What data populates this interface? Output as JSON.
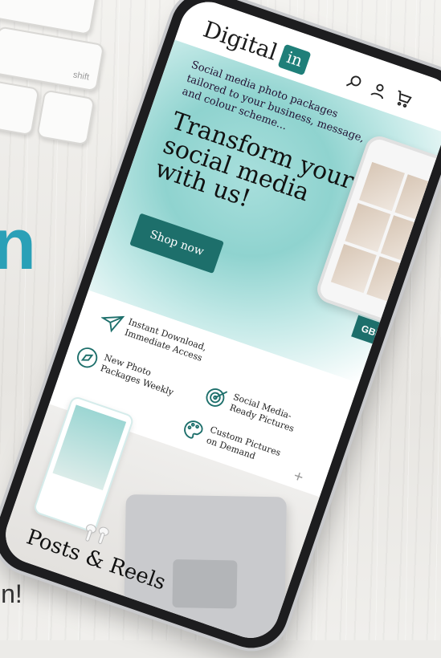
{
  "background": {
    "keyboard_key_label": "shift",
    "partial_heading": "n",
    "partial_bottom_text": "in!"
  },
  "site": {
    "logo_text": "Digital",
    "logo_badge": "in",
    "header_icons": [
      "search-icon",
      "user-icon",
      "cart-icon"
    ],
    "hero": {
      "subtitle": "Social media photo packages tailored to your business, message, and colour scheme...",
      "title": "Transform your social media with us!",
      "button_label": "Shop now"
    },
    "currency_badge": "GBP",
    "features": [
      {
        "icon": "paper-plane-icon",
        "label": "Instant Download, Immediate Access"
      },
      {
        "icon": "compass-icon",
        "label": "New Photo Packages Weekly"
      },
      {
        "icon": "target-icon",
        "label": "Social Media-Ready Pictures"
      },
      {
        "icon": "palette-icon",
        "label": "Custom Pictures on Demand"
      }
    ],
    "posts_title": "Posts & Reels"
  },
  "colors": {
    "brand_teal": "#1d6f6b",
    "hero_teal": "#8fd3cf",
    "accent_blue": "#2aa0b7"
  }
}
